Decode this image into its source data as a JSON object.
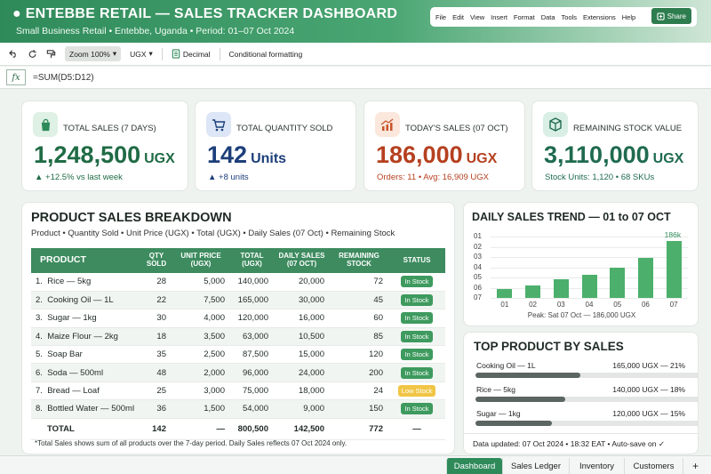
{
  "header": {
    "title": "● ENTEBBE RETAIL — SALES TRACKER DASHBOARD",
    "subtitle": "Small Business Retail • Entebbe, Uganda • Period: 01–07 Oct 2024",
    "menu": [
      "File",
      "Edit",
      "View",
      "Insert",
      "Format",
      "Data",
      "Tools",
      "Extensions",
      "Help"
    ],
    "share_label": "Share"
  },
  "toolbar": {
    "zoom": "Zoom 100%",
    "currency": "UGX",
    "decimal": "Decimal",
    "conditional": "Conditional formatting"
  },
  "formula_bar": {
    "fx": "fx",
    "formula": "=SUM(D5:D12)"
  },
  "kpis": [
    {
      "label": "TOTAL SALES (7 DAYS)",
      "value": "1,248,500",
      "unit": "UGX",
      "note": "▲ +12.5% vs last week",
      "color": "#1f6b45",
      "icon": "shopping-bag-icon"
    },
    {
      "label": "TOTAL QUANTITY SOLD",
      "value": "142",
      "unit": "Units",
      "note": "▲ +8 units",
      "color": "#1d3f7a",
      "icon": "cart-icon"
    },
    {
      "label": "TODAY'S SALES (07 OCT)",
      "value": "186,000",
      "unit": "UGX",
      "note": "Orders: 11 • Avg: 16,909 UGX",
      "color": "#b5401f",
      "icon": "trend-chart-icon"
    },
    {
      "label": "REMAINING STOCK VALUE",
      "value": "3,110,000",
      "unit": "UGX",
      "note": "Stock Units: 1,120 • 68 SKUs",
      "color": "#1f6b4f",
      "icon": "box-icon"
    }
  ],
  "breakdown": {
    "title": "PRODUCT SALES BREAKDOWN",
    "subtitle": "Product • Quantity Sold • Unit Price (UGX) • Total (UGX) • Daily Sales (07 Oct) • Remaining Stock",
    "headers": [
      "PRODUCT",
      "QTY SOLD",
      "UNIT PRICE (UGX)",
      "TOTAL (UGX)",
      "DAILY SALES (07 OCT)",
      "REMAINING STOCK",
      "STATUS"
    ],
    "rows": [
      [
        "1.",
        "Rice — 5kg",
        "28",
        "5,000",
        "140,000",
        "20,000",
        "72",
        "In Stock"
      ],
      [
        "2.",
        "Cooking Oil — 1L",
        "22",
        "7,500",
        "165,000",
        "30,000",
        "45",
        "In Stock"
      ],
      [
        "3.",
        "Sugar — 1kg",
        "30",
        "4,000",
        "120,000",
        "16,000",
        "60",
        "In Stock"
      ],
      [
        "4.",
        "Maize Flour — 2kg",
        "18",
        "3,500",
        "63,000",
        "10,500",
        "85",
        "In Stock"
      ],
      [
        "5.",
        "Soap Bar",
        "35",
        "2,500",
        "87,500",
        "15,000",
        "120",
        "In Stock"
      ],
      [
        "6.",
        "Soda — 500ml",
        "48",
        "2,000",
        "96,000",
        "24,000",
        "200",
        "In Stock"
      ],
      [
        "7.",
        "Bread — Loaf",
        "25",
        "3,000",
        "75,000",
        "18,000",
        "24",
        "Low Stock"
      ],
      [
        "8.",
        "Bottled Water — 500ml",
        "36",
        "1,500",
        "54,000",
        "9,000",
        "150",
        "In Stock"
      ]
    ],
    "total": [
      "TOTAL",
      "142",
      "—",
      "800,500",
      "142,500",
      "772",
      "—"
    ],
    "footnote": "*Total Sales shows sum of all products over the 7-day period. Daily Sales reflects 07 Oct 2024 only."
  },
  "trend": {
    "title": "DAILY SALES TREND — 01 to 07 OCT",
    "peak_label": "186k",
    "caption": "Peak: Sat 07 Oct — 186,000 UGX"
  },
  "chart_data": {
    "type": "bar",
    "title": "DAILY SALES TREND — 01 to 07 OCT",
    "categories": [
      "01",
      "02",
      "03",
      "04",
      "05",
      "06",
      "07"
    ],
    "values": [
      28000,
      40000,
      62000,
      76000,
      100000,
      131000,
      186000
    ],
    "ytick_labels": [
      "01",
      "02",
      "03",
      "04",
      "05",
      "06",
      "07"
    ],
    "ylim": [
      0,
      200000
    ],
    "grid": true,
    "color": "#4caf6c"
  },
  "top_products": {
    "title": "TOP PRODUCT BY SALES",
    "items": [
      {
        "name": "Cooking Oil — 1L",
        "value": "165,000 UGX — 21%",
        "share": 0.47
      },
      {
        "name": "Rice — 5kg",
        "value": "140,000 UGX — 18%",
        "share": 0.4
      },
      {
        "name": "Sugar — 1kg",
        "value": "120,000 UGX — 15%",
        "share": 0.34
      }
    ],
    "updated": "Data updated: 07 Oct 2024 • 18:32 EAT • Auto-save on ✓"
  },
  "tabs": [
    "Dashboard",
    "Sales Ledger",
    "Inventory",
    "Customers",
    "+"
  ]
}
